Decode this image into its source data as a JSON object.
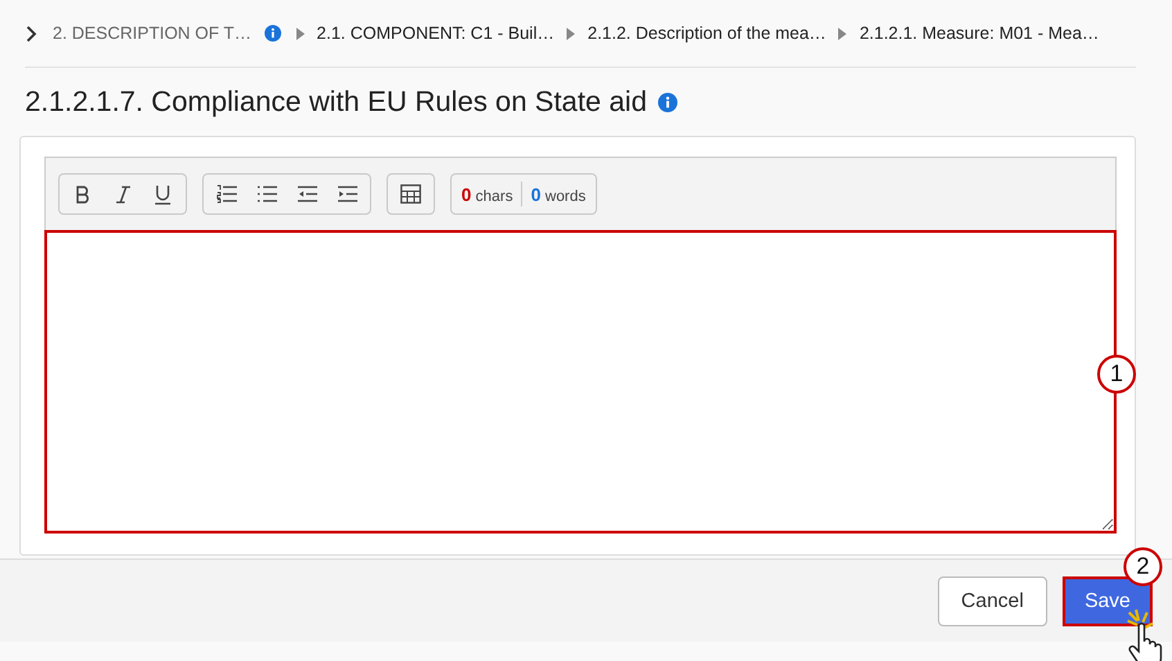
{
  "breadcrumb": [
    {
      "label": "2. DESCRIPTION OF T…",
      "current": false
    },
    {
      "label": "2.1. COMPONENT: C1 - Buil…",
      "current": true
    },
    {
      "label": "2.1.2. Description of the mea…",
      "current": true
    },
    {
      "label": "2.1.2.1. Measure: M01 - Mea…",
      "current": true
    }
  ],
  "title": "2.1.2.1.7. Compliance with EU Rules on State aid",
  "editor": {
    "chars_count": "0",
    "chars_label": "chars",
    "words_count": "0",
    "words_label": "words"
  },
  "callouts": [
    "1",
    "2"
  ],
  "buttons": [
    {
      "label": "Cancel",
      "kind": "secondary"
    },
    {
      "label": "Save",
      "kind": "primary"
    }
  ]
}
